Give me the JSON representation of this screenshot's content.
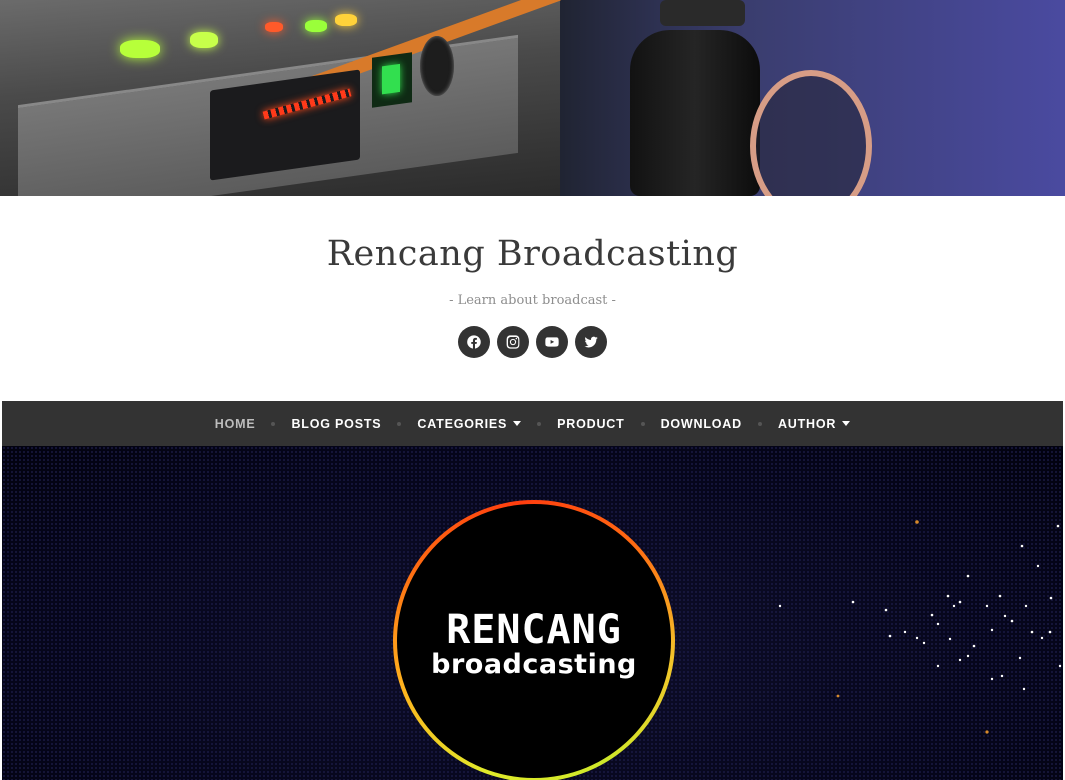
{
  "site": {
    "title": "Rencang Broadcasting",
    "description": "- Learn about broadcast -"
  },
  "social": [
    {
      "name": "facebook",
      "icon": "facebook-icon"
    },
    {
      "name": "instagram",
      "icon": "instagram-icon"
    },
    {
      "name": "youtube",
      "icon": "youtube-icon"
    },
    {
      "name": "twitter",
      "icon": "twitter-icon"
    }
  ],
  "nav": {
    "items": [
      {
        "label": "HOME",
        "active": true,
        "dropdown": false
      },
      {
        "label": "BLOG POSTS",
        "active": false,
        "dropdown": false
      },
      {
        "label": "CATEGORIES",
        "active": false,
        "dropdown": true
      },
      {
        "label": "PRODUCT",
        "active": false,
        "dropdown": false
      },
      {
        "label": "DOWNLOAD",
        "active": false,
        "dropdown": false
      },
      {
        "label": "AUTHOR",
        "active": false,
        "dropdown": true
      }
    ]
  },
  "feature": {
    "logo_line1": "RENCANG",
    "logo_line2": "broadcasting"
  },
  "colors": {
    "nav_bg": "#333333",
    "title": "#3a3a3a",
    "ring_start": "#e0ea2a",
    "ring_end": "#ff3d0f"
  }
}
